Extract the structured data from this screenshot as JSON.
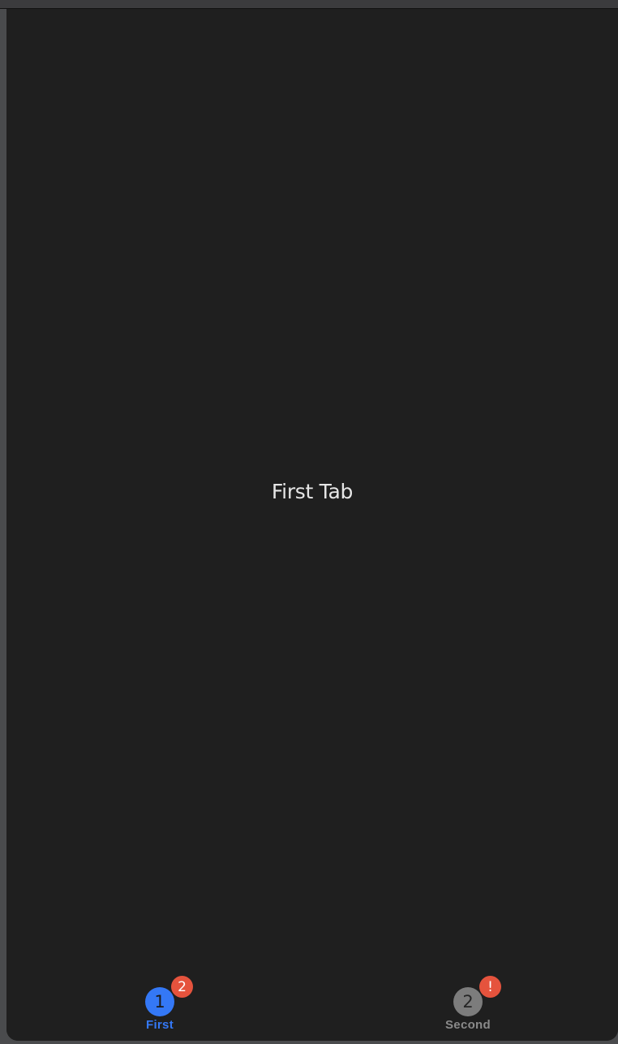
{
  "content": {
    "title": "First Tab"
  },
  "tabbar": {
    "tabs": [
      {
        "label": "First",
        "icon_text": "1",
        "icon": "number-1-circle-icon",
        "badge": "2",
        "selected": true,
        "color": "#3478f6"
      },
      {
        "label": "Second",
        "icon_text": "2",
        "icon": "number-2-circle-icon",
        "badge": "!",
        "selected": false,
        "color": "#8a8a8a"
      }
    ],
    "badge_color": "#e5533d"
  },
  "colors": {
    "background": "#1f1f1f",
    "text": "#e6e6e6"
  }
}
